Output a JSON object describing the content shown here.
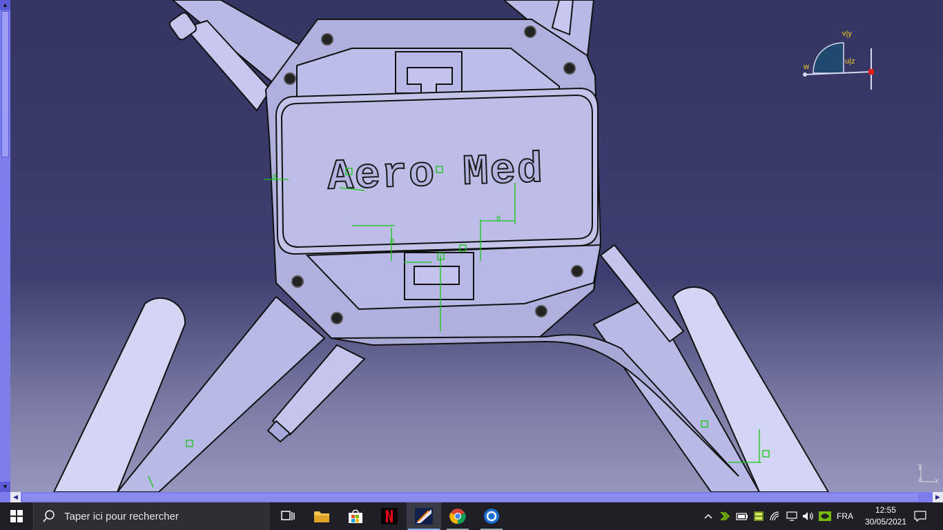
{
  "model": {
    "engraved_text": "Aero Med",
    "dimension_labels": [
      "8",
      "8",
      "8"
    ]
  },
  "compass": {
    "axis_v": "v|y",
    "axis_w": "w",
    "axis_u": "u|z"
  },
  "mini_axis": {
    "y": "y",
    "z": "z",
    "x": "x"
  },
  "scrollbar": {
    "up": "▲",
    "down": "▼",
    "left": "◀",
    "right": "▶"
  },
  "taskbar": {
    "search_placeholder": "Taper ici pour rechercher",
    "language": "FRA",
    "time": "12:55",
    "date": "30/05/2021",
    "apps": [
      "task-view",
      "file-explorer",
      "microsoft-store",
      "netflix",
      "catia",
      "chrome",
      "app-blue"
    ]
  },
  "colors": {
    "background_top": "#353563",
    "background_bottom": "#9090b6",
    "part_fill": "#b5b5e3",
    "constraint": "#12c812",
    "taskbar": "#1f1f25"
  }
}
